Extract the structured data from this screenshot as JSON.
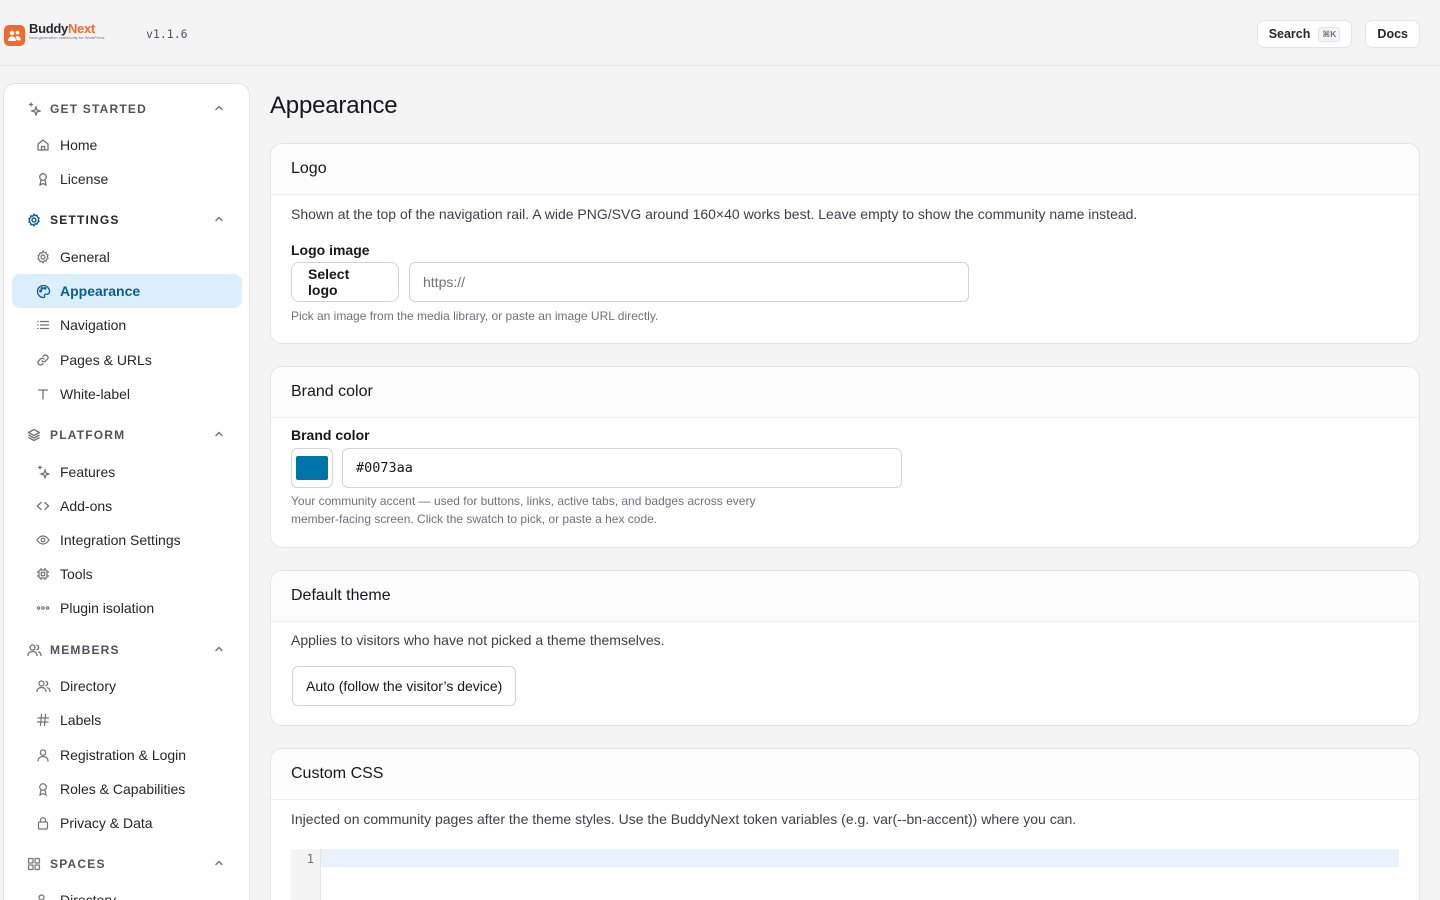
{
  "brand": {
    "name_part1": "Buddy",
    "name_part2": "Next",
    "tagline": "Next-generation community for WordPress",
    "version": "v1.1.6",
    "accent": "#ef6a2e"
  },
  "topbar": {
    "search_label": "Search",
    "search_kbd": "⌘K",
    "docs_label": "Docs"
  },
  "sidebar": {
    "sections": [
      {
        "label": "GET STARTED",
        "icon": "sparkles-icon"
      },
      {
        "label": "SETTINGS",
        "icon": "gear-icon"
      },
      {
        "label": "PLATFORM",
        "icon": "layers-icon"
      },
      {
        "label": "MEMBERS",
        "icon": "users-icon"
      },
      {
        "label": "SPACES",
        "icon": "grid-icon"
      }
    ],
    "items": {
      "home": "Home",
      "license": "License",
      "general": "General",
      "appearance": "Appearance",
      "navigation": "Navigation",
      "pages": "Pages & URLs",
      "whitelabel": "White-label",
      "features": "Features",
      "addons": "Add-ons",
      "integration": "Integration Settings",
      "tools": "Tools",
      "isolation": "Plugin isolation",
      "directory": "Directory",
      "labels": "Labels",
      "registration": "Registration & Login",
      "roles": "Roles & Capabilities",
      "privacy": "Privacy & Data",
      "spaces_directory": "Directory"
    },
    "selected": "appearance",
    "selected_bg": "#dbeefb",
    "selected_color": "#0b5f8f"
  },
  "main": {
    "title": "Appearance",
    "logo_card": {
      "title": "Logo",
      "description": "Shown at the top of the navigation rail. A wide PNG/SVG around 160×40 works best. Leave empty to show the community name instead.",
      "field_label": "Logo image",
      "select_button": "Select logo",
      "url_placeholder": "https://",
      "url_value": "",
      "hint": "Pick an image from the media library, or paste an image URL directly."
    },
    "brand_card": {
      "title": "Brand color",
      "field_label": "Brand color",
      "color_value": "#0073aa",
      "hint_line1": "Your community accent — used for buttons, links, active tabs, and badges across every",
      "hint_line2": "member-facing screen. Click the swatch to pick, or paste a hex code."
    },
    "theme_card": {
      "title": "Default theme",
      "description": "Applies to visitors who have not picked a theme themselves.",
      "select_value": "Auto (follow the visitor’s device)"
    },
    "css_card": {
      "title": "Custom CSS",
      "description": "Injected on community pages after the theme styles. Use the BuddyNext token variables (e.g. var(--bn-accent)) where you can.",
      "line_number": "1"
    }
  }
}
